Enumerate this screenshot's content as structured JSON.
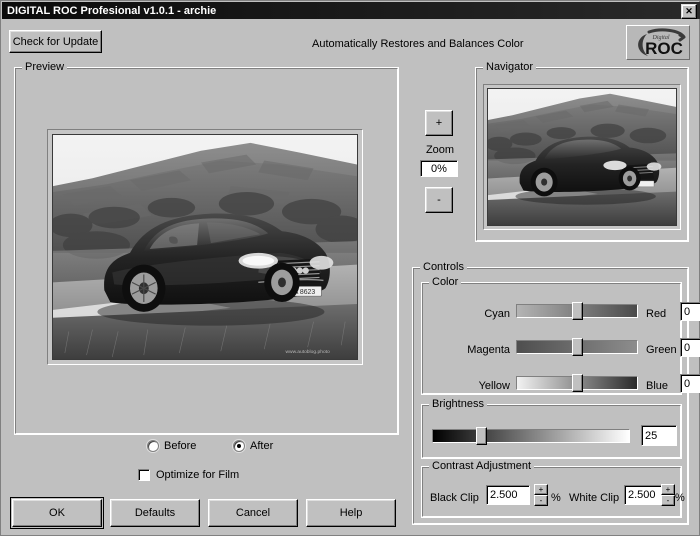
{
  "window": {
    "title": "DIGITAL ROC Profesional v1.0.1 - archie",
    "close_label": "✕",
    "tagline": "Automatically Restores and Balances Color",
    "logo_top_text": "Digital",
    "logo_main_text": "ROC"
  },
  "toolbar": {
    "check_update_label": "Check for Update"
  },
  "preview": {
    "group_label": "Preview",
    "image_alt": "grayscale photo of dark Audi sedan on road with hills"
  },
  "zoom": {
    "plus_label": "+",
    "label": "Zoom",
    "value": "0%",
    "minus_label": "-"
  },
  "navigator": {
    "group_label": "Navigator",
    "image_alt": "thumbnail of the same grayscale Audi photo"
  },
  "controls": {
    "group_label": "Controls",
    "color": {
      "group_label": "Color",
      "rows": [
        {
          "left_label": "Cyan",
          "right_label": "Red",
          "value": "0",
          "thumb_pct": 50,
          "track_from": "#b4b4b4",
          "track_to": "#4a4a4a"
        },
        {
          "left_label": "Magenta",
          "right_label": "Green",
          "value": "0",
          "thumb_pct": 50,
          "track_from": "#4e4e4e",
          "track_to": "#8d8d8d"
        },
        {
          "left_label": "Yellow",
          "right_label": "Blue",
          "value": "0",
          "thumb_pct": 50,
          "track_from": "#f2f2f2",
          "track_to": "#2a2a2a"
        }
      ]
    },
    "brightness": {
      "group_label": "Brightness",
      "value": "25",
      "thumb_pct": 25,
      "track_from": "#000000",
      "track_to": "#ffffff"
    },
    "contrast": {
      "group_label": "Contrast Adjustment",
      "black_clip_label": "Black Clip",
      "black_clip_value": "2.500",
      "white_clip_label": "White Clip",
      "white_clip_value": "2.500",
      "percent_symbol": "%",
      "spin_up_label": "+",
      "spin_down_label": "-"
    }
  },
  "view_mode": {
    "before_label": "Before",
    "after_label": "After",
    "selected": "After"
  },
  "options": {
    "optimize_for_film_label": "Optimize for Film",
    "optimize_for_film_checked": false
  },
  "buttons": {
    "ok": "OK",
    "defaults": "Defaults",
    "cancel": "Cancel",
    "help": "Help"
  },
  "colors": {
    "face": "#c0c0c0",
    "title_bar": "#0b0b0b",
    "field_bg": "#ffffff"
  }
}
